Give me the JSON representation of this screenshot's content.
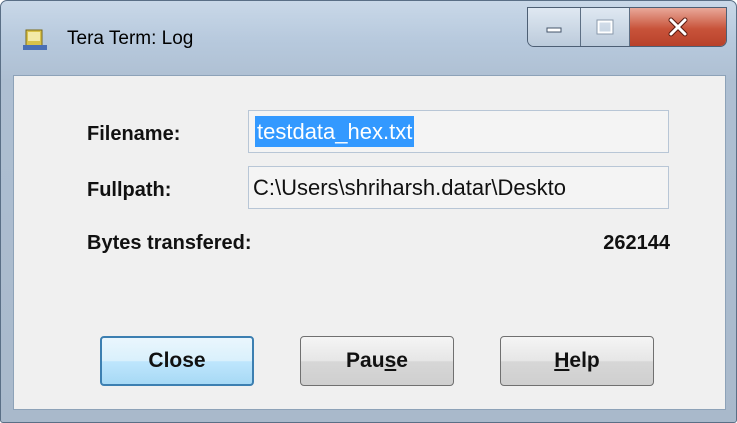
{
  "window": {
    "title": "Tera Term: Log"
  },
  "titlebar": {
    "icons": [
      "app-icon",
      "minimize-icon",
      "maximize-icon",
      "close-icon"
    ]
  },
  "dialog": {
    "filename_label": "Filename:",
    "filename_value": "testdata_hex.txt",
    "fullpath_label": "Fullpath:",
    "fullpath_value": "C:\\Users\\shriharsh.datar\\Deskto",
    "bytes_label": "Bytes transfered:",
    "bytes_value": "262144"
  },
  "buttons": {
    "close": "Close",
    "pause": {
      "pre": "Pau",
      "accel": "s",
      "post": "e"
    },
    "help": {
      "accel": "H",
      "post": "elp"
    }
  },
  "colors": {
    "selection": "#3399ff",
    "close_button": "#c8533a",
    "default_button_border": "#3c7fb1"
  }
}
